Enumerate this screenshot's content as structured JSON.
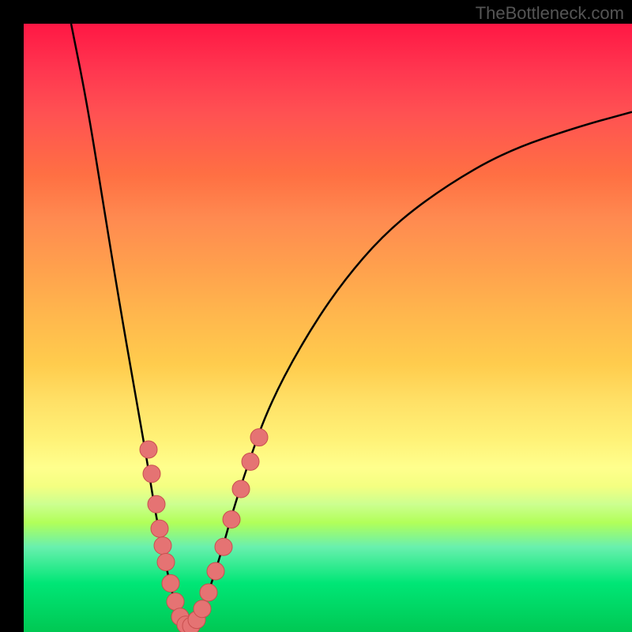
{
  "watermark": "TheBottleneck.com",
  "chart_data": {
    "type": "line",
    "title": "",
    "xlabel": "",
    "ylabel": "",
    "x_range": [
      0,
      770
    ],
    "y_range_visual": [
      0,
      770
    ],
    "background_gradient": {
      "description": "vertical gradient red (top, high bottleneck) to green (bottom, low bottleneck)",
      "stops": [
        {
          "pos": 0.0,
          "color": "#ff1744"
        },
        {
          "pos": 0.5,
          "color": "#ffcc4d"
        },
        {
          "pos": 0.75,
          "color": "#ffff8d"
        },
        {
          "pos": 1.0,
          "color": "#00c853"
        }
      ]
    },
    "series": [
      {
        "name": "bottleneck-curve",
        "description": "V-shaped curve: steeply descending left arm, minimum near x≈200, rising right arm leveling off; y expressed as fraction of plot height from top (0=top, 1=bottom)",
        "points": [
          {
            "x": 60,
            "y_frac": 0.0
          },
          {
            "x": 80,
            "y_frac": 0.13
          },
          {
            "x": 100,
            "y_frac": 0.29
          },
          {
            "x": 120,
            "y_frac": 0.45
          },
          {
            "x": 140,
            "y_frac": 0.6
          },
          {
            "x": 155,
            "y_frac": 0.71
          },
          {
            "x": 165,
            "y_frac": 0.79
          },
          {
            "x": 175,
            "y_frac": 0.86
          },
          {
            "x": 185,
            "y_frac": 0.92
          },
          {
            "x": 195,
            "y_frac": 0.97
          },
          {
            "x": 205,
            "y_frac": 0.99
          },
          {
            "x": 215,
            "y_frac": 0.99
          },
          {
            "x": 225,
            "y_frac": 0.97
          },
          {
            "x": 235,
            "y_frac": 0.93
          },
          {
            "x": 250,
            "y_frac": 0.87
          },
          {
            "x": 265,
            "y_frac": 0.8
          },
          {
            "x": 285,
            "y_frac": 0.72
          },
          {
            "x": 310,
            "y_frac": 0.63
          },
          {
            "x": 350,
            "y_frac": 0.53
          },
          {
            "x": 400,
            "y_frac": 0.43
          },
          {
            "x": 460,
            "y_frac": 0.34
          },
          {
            "x": 530,
            "y_frac": 0.27
          },
          {
            "x": 610,
            "y_frac": 0.21
          },
          {
            "x": 700,
            "y_frac": 0.17
          },
          {
            "x": 770,
            "y_frac": 0.145
          }
        ]
      },
      {
        "name": "data-dots",
        "description": "pink/salmon scatter points clustered along the V near the bottom",
        "points": [
          {
            "x": 158,
            "y_frac": 0.7
          },
          {
            "x": 162,
            "y_frac": 0.74
          },
          {
            "x": 168,
            "y_frac": 0.79
          },
          {
            "x": 172,
            "y_frac": 0.83
          },
          {
            "x": 176,
            "y_frac": 0.858
          },
          {
            "x": 180,
            "y_frac": 0.885
          },
          {
            "x": 186,
            "y_frac": 0.92
          },
          {
            "x": 192,
            "y_frac": 0.95
          },
          {
            "x": 198,
            "y_frac": 0.975
          },
          {
            "x": 205,
            "y_frac": 0.988
          },
          {
            "x": 212,
            "y_frac": 0.99
          },
          {
            "x": 219,
            "y_frac": 0.98
          },
          {
            "x": 226,
            "y_frac": 0.962
          },
          {
            "x": 234,
            "y_frac": 0.935
          },
          {
            "x": 243,
            "y_frac": 0.9
          },
          {
            "x": 253,
            "y_frac": 0.86
          },
          {
            "x": 263,
            "y_frac": 0.815
          },
          {
            "x": 275,
            "y_frac": 0.765
          },
          {
            "x": 287,
            "y_frac": 0.72
          },
          {
            "x": 298,
            "y_frac": 0.68
          }
        ],
        "dot_radius": 11,
        "color": "#e57373"
      }
    ]
  }
}
